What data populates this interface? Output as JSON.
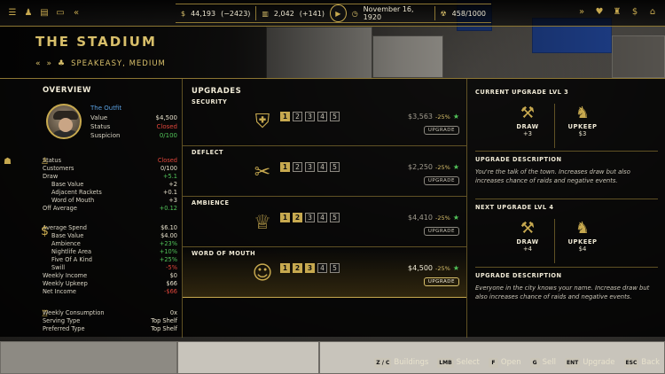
{
  "top": {
    "money": "44,193",
    "money_delta": "(−2423)",
    "beer": "2,042",
    "beer_delta": "(+141)",
    "date": "November 16, 1920",
    "heat": "458/1000"
  },
  "header": {
    "title": "THE STADIUM",
    "subtitle": "SPEAKEASY, MEDIUM"
  },
  "overview": {
    "title": "OVERVIEW",
    "owner_name": "The Outfit",
    "owner_rows": [
      {
        "k": "Value",
        "v": "$4,500"
      },
      {
        "k": "Status",
        "v": "Closed"
      },
      {
        "k": "Suspicion",
        "v": "0/100"
      }
    ],
    "status_rows": [
      {
        "k": "Status",
        "v": "Closed"
      },
      {
        "k": "Customers",
        "v": "0/100"
      },
      {
        "k": "Draw",
        "v": "+5.1"
      },
      {
        "k": "Base Value",
        "v": "+2"
      },
      {
        "k": "Adjacent Rackets",
        "v": "+0.1"
      },
      {
        "k": "Word of Mouth",
        "v": "+3"
      },
      {
        "k": "Off Average",
        "v": "+0.12"
      }
    ],
    "money_rows": [
      {
        "k": "Average Spend",
        "v": "$6.10"
      },
      {
        "k": "Base Value",
        "v": "$4.00"
      },
      {
        "k": "Ambience",
        "v": "+23%"
      },
      {
        "k": "Nightlife Area",
        "v": "+10%"
      },
      {
        "k": "Five Of A Kind",
        "v": "+25%"
      },
      {
        "k": "Swill",
        "v": "-5%"
      },
      {
        "k": "Weekly Income",
        "v": "$0"
      },
      {
        "k": "Weekly Upkeep",
        "v": "$66"
      },
      {
        "k": "Net Income",
        "v": "-$66"
      }
    ],
    "consumption_rows": [
      {
        "k": "Weekly Consumption",
        "v": "0x"
      },
      {
        "k": "Serving Type",
        "v": "Top Shelf"
      },
      {
        "k": "Preferred Type",
        "v": "Top Shelf"
      }
    ]
  },
  "upgrades": {
    "title": "UPGRADES",
    "levels": [
      "1",
      "2",
      "3",
      "4",
      "5"
    ],
    "button": "UPGRADE",
    "rows": [
      {
        "label": "SECURITY",
        "cost": "$3,563",
        "pct": "-25%",
        "owned": 1
      },
      {
        "label": "DEFLECT",
        "cost": "$2,250",
        "pct": "-25%",
        "owned": 1
      },
      {
        "label": "AMBIENCE",
        "cost": "$4,410",
        "pct": "-25%",
        "owned": 2
      },
      {
        "label": "WORD OF MOUTH",
        "cost": "$4,500",
        "pct": "-25%",
        "owned": 3
      }
    ]
  },
  "right": {
    "current_title": "CURRENT UPGRADE LVL 3",
    "current_draw_label": "DRAW",
    "current_draw": "+3",
    "current_upkeep_label": "UPKEEP",
    "current_upkeep": "$3",
    "desc1_title": "UPGRADE DESCRIPTION",
    "desc1": "You're the talk of the town. Increases draw but also increases chance of raids and negative events.",
    "next_title": "NEXT UPGRADE LVL 4",
    "next_draw_label": "DRAW",
    "next_draw": "+4",
    "next_upkeep_label": "UPKEEP",
    "next_upkeep": "$4",
    "desc2_title": "UPGRADE DESCRIPTION",
    "desc2": "Everyone in the city knows your name. Increase draw but also increases chance of raids and negative events."
  },
  "bottom": [
    {
      "key": "Z / C",
      "label": "Buildings"
    },
    {
      "key": "LMB",
      "label": "Select"
    },
    {
      "key": "F",
      "label": "Open"
    },
    {
      "key": "G",
      "label": "Sell"
    },
    {
      "key": "ENT",
      "label": "Upgrade"
    },
    {
      "key": "ESC",
      "label": "Back"
    }
  ]
}
